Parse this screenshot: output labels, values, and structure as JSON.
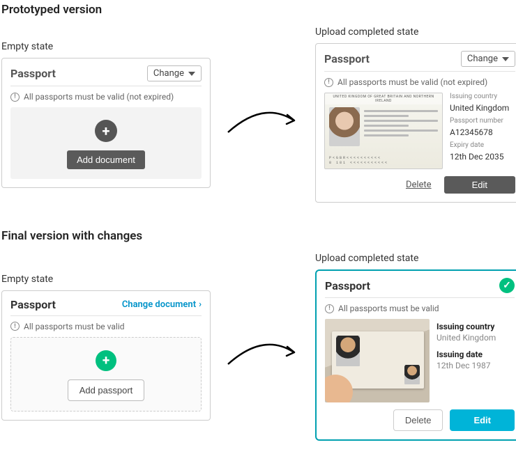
{
  "sections": {
    "proto_title": "Prototyped version",
    "final_title": "Final version with changes"
  },
  "state_labels": {
    "empty": "Empty state",
    "completed": "Upload completed state"
  },
  "proto": {
    "card_title": "Passport",
    "change_label": "Change",
    "info_text": "All passports must be valid (not expired)",
    "add_label": "Add document",
    "delete_label": "Delete",
    "edit_label": "Edit",
    "details": {
      "issuing_country_label": "Issuing country",
      "issuing_country_value": "United Kingdom",
      "passport_number_label": "Passport number",
      "passport_number_value": "A12345678",
      "expiry_label": "Expiry date",
      "expiry_value": "12th Dec 2035"
    },
    "passport_mock": {
      "header": "UNITED KINGDOM OF GREAT BRITAIN AND NORTHERN IRELAND"
    }
  },
  "final": {
    "card_title": "Passport",
    "change_label": "Change document",
    "info_text": "All passports must be valid",
    "add_label": "Add passport",
    "delete_label": "Delete",
    "edit_label": "Edit",
    "details": {
      "issuing_country_label": "Issuing country",
      "issuing_country_value": "United Kingdom",
      "issuing_date_label": "Issuing date",
      "issuing_date_value": "12th Dec 1987"
    }
  }
}
